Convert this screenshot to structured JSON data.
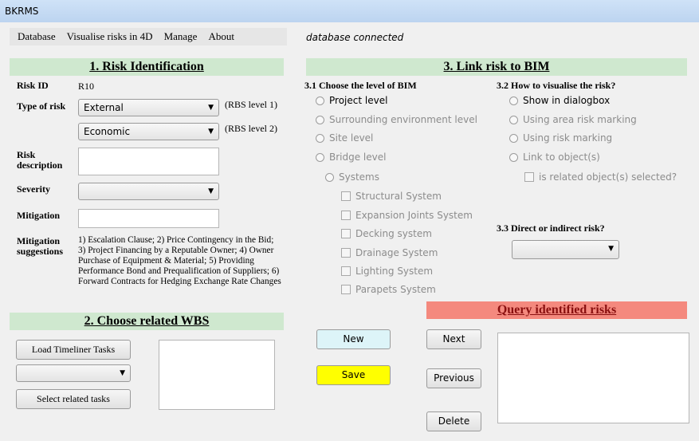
{
  "window": {
    "title": "BKRMS"
  },
  "menu": [
    "Database",
    "Visualise risks in 4D",
    "Manage",
    "About"
  ],
  "status": "database connected",
  "risk_identification": {
    "heading": "1. Risk Identification",
    "risk_id_label": "Risk ID",
    "risk_id_value": "R10",
    "type_label": "Type of risk",
    "type_level1_value": "External",
    "type_level1_note": "(RBS level 1)",
    "type_level2_value": "Economic",
    "type_level2_note": "(RBS level 2)",
    "description_label": "Risk description",
    "description_value": "",
    "severity_label": "Severity",
    "severity_value": "",
    "mitigation_label": "Mitigation",
    "mitigation_value": "",
    "suggestions_label": "Mitigation suggestions",
    "suggestions_text": "1) Escalation Clause; 2) Price Contingency in the Bid; 3) Project Financing by a Reputable Owner; 4) Owner Purchase of Equipment & Material; 5) Providing Performance Bond and Prequalification of Suppliers; 6) Forward Contracts for Hedging Exchange Rate Changes"
  },
  "wbs": {
    "heading": "2. Choose related WBS",
    "load_button": "Load Timeliner Tasks",
    "select_value": "",
    "select_button": "Select related tasks"
  },
  "link_bim": {
    "heading": "3. Link risk to BIM",
    "level_heading": "3.1 Choose the level of BIM",
    "levels": [
      "Project level",
      "Surrounding environment level",
      "Site level",
      "Bridge level"
    ],
    "systems_label": "Systems",
    "systems": [
      "Structural System",
      "Expansion Joints System",
      "Decking system",
      "Drainage System",
      "Lighting System",
      "Parapets System"
    ],
    "visualise_heading": "3.2 How to visualise the risk?",
    "visualise_options": [
      "Show in dialogbox",
      "Using area risk marking",
      "Using risk marking",
      "Link to object(s)"
    ],
    "related_check_label": "is related object(s) selected?",
    "direct_heading": "3.3 Direct or indirect risk?",
    "direct_value": ""
  },
  "actions": {
    "new": "New",
    "save": "Save",
    "next": "Next",
    "previous": "Previous",
    "delete": "Delete"
  },
  "query": {
    "heading": "Query identified risks"
  },
  "colors": {
    "section_green": "#cfe8cf",
    "query_red": "#f4897e",
    "save_yellow": "#ffff00",
    "new_blue": "#ddf4f8"
  }
}
